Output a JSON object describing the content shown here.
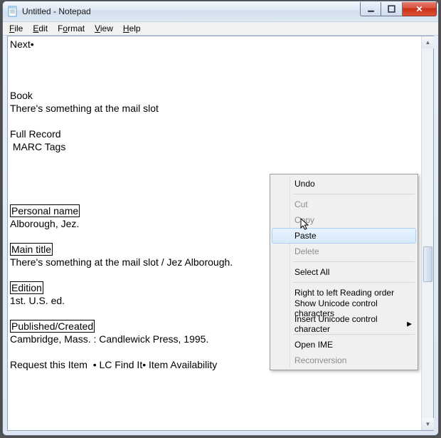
{
  "window": {
    "title": "Untitled - Notepad"
  },
  "menu": {
    "file": "File",
    "edit": "Edit",
    "format": "Format",
    "view": "View",
    "help": "Help"
  },
  "content": {
    "line1": "Next",
    "line_book": "Book",
    "line_book2": "There's something at the mail slot",
    "line_full": "Full Record",
    "line_marc": " MARC Tags",
    "label_personal": "Personal name",
    "val_personal": "Alborough, Jez.",
    "label_main": "Main title",
    "val_main": "There's something at the mail slot / Jez Alborough.",
    "label_edition": "Edition",
    "val_edition": "1st. U.S. ed.",
    "label_pub": "Published/Created",
    "val_pub": "Cambridge, Mass. : Candlewick Press, 1995.",
    "line_request": "Request this Item  ",
    "lc_find": " LC Find It",
    "item_avail": " Item Availability",
    "bullet": "•"
  },
  "context_menu": {
    "undo": "Undo",
    "cut": "Cut",
    "copy": "Copy",
    "paste": "Paste",
    "delete": "Delete",
    "select_all": "Select All",
    "rtl": "Right to left Reading order",
    "show_unicode": "Show Unicode control characters",
    "insert_unicode": "Insert Unicode control character",
    "open_ime": "Open IME",
    "reconversion": "Reconversion"
  }
}
